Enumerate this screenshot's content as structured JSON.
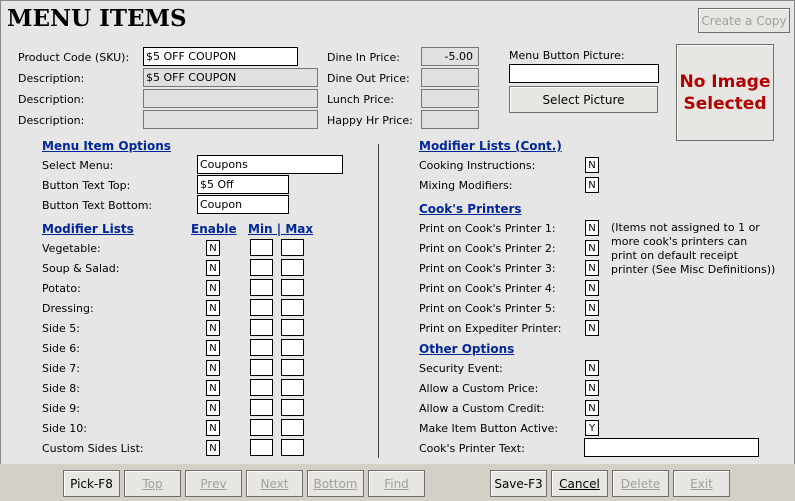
{
  "title": "MENU ITEMS",
  "create_copy_label": "Create a Copy",
  "product": {
    "sku_label": "Product Code (SKU):",
    "sku_value": "$5 OFF COUPON",
    "desc_label": "Description:",
    "desc1_value": "$5 OFF COUPON",
    "desc2_value": "",
    "desc3_value": ""
  },
  "prices": {
    "dine_in_label": "Dine In Price:",
    "dine_in_value": "-5.00",
    "dine_out_label": "Dine Out Price:",
    "dine_out_value": "",
    "lunch_label": "Lunch Price:",
    "lunch_value": "",
    "happy_hr_label": "Happy Hr Price:",
    "happy_hr_value": ""
  },
  "picture": {
    "label": "Menu Button Picture:",
    "value": "",
    "select_label": "Select Picture",
    "no_image_line1": "No Image",
    "no_image_line2": "Selected"
  },
  "options": {
    "heading": "Menu Item Options",
    "select_menu_label": "Select Menu:",
    "select_menu_value": "Coupons",
    "btn_top_label": "Button Text Top:",
    "btn_top_value": "$5 Off",
    "btn_bottom_label": "Button Text Bottom:",
    "btn_bottom_value": "Coupon"
  },
  "modifiers": {
    "heading": "Modifier Lists",
    "enable_heading": "Enable",
    "minmax_heading": "Min | Max",
    "rows": [
      {
        "label": "Vegetable:",
        "enable": "N"
      },
      {
        "label": "Soup & Salad:",
        "enable": "N"
      },
      {
        "label": "Potato:",
        "enable": "N"
      },
      {
        "label": "Dressing:",
        "enable": "N"
      },
      {
        "label": "Side 5:",
        "enable": "N"
      },
      {
        "label": "Side 6:",
        "enable": "N"
      },
      {
        "label": "Side 7:",
        "enable": "N"
      },
      {
        "label": "Side 8:",
        "enable": "N"
      },
      {
        "label": "Side 9:",
        "enable": "N"
      },
      {
        "label": "Side 10:",
        "enable": "N"
      },
      {
        "label": "Custom Sides List:",
        "enable": "N"
      }
    ]
  },
  "modifiers_cont": {
    "heading": "Modifier Lists (Cont.)",
    "rows": [
      {
        "label": "Cooking Instructions:",
        "value": "N"
      },
      {
        "label": "Mixing Modifiers:",
        "value": "N"
      }
    ]
  },
  "printers": {
    "heading": "Cook's Printers",
    "rows": [
      {
        "label": "Print on Cook's Printer 1:",
        "value": "N"
      },
      {
        "label": "Print on Cook's Printer 2:",
        "value": "N"
      },
      {
        "label": "Print on Cook's Printer 3:",
        "value": "N"
      },
      {
        "label": "Print on Cook's Printer 4:",
        "value": "N"
      },
      {
        "label": "Print on Cook's Printer 5:",
        "value": "N"
      },
      {
        "label": "Print on Expediter Printer:",
        "value": "N"
      }
    ],
    "note": "(Items not assigned to 1 or more cook's printers can print on default receipt printer (See Misc Definitions))"
  },
  "other": {
    "heading": "Other Options",
    "rows": [
      {
        "label": "Security Event:",
        "value": "N"
      },
      {
        "label": "Allow a Custom Price:",
        "value": "N"
      },
      {
        "label": "Allow a Custom Credit:",
        "value": "N"
      },
      {
        "label": "Make Item Button Active:",
        "value": "Y"
      }
    ],
    "printer_text_label": "Cook's Printer Text:",
    "printer_text_value": ""
  },
  "toolbar": {
    "pick": "Pick-F8",
    "top": "Top",
    "prev": "Prev",
    "next": "Next",
    "bottom": "Bottom",
    "find": "Find",
    "save": "Save-F3",
    "cancel": "Cancel",
    "delete": "Delete",
    "exit": "Exit"
  }
}
